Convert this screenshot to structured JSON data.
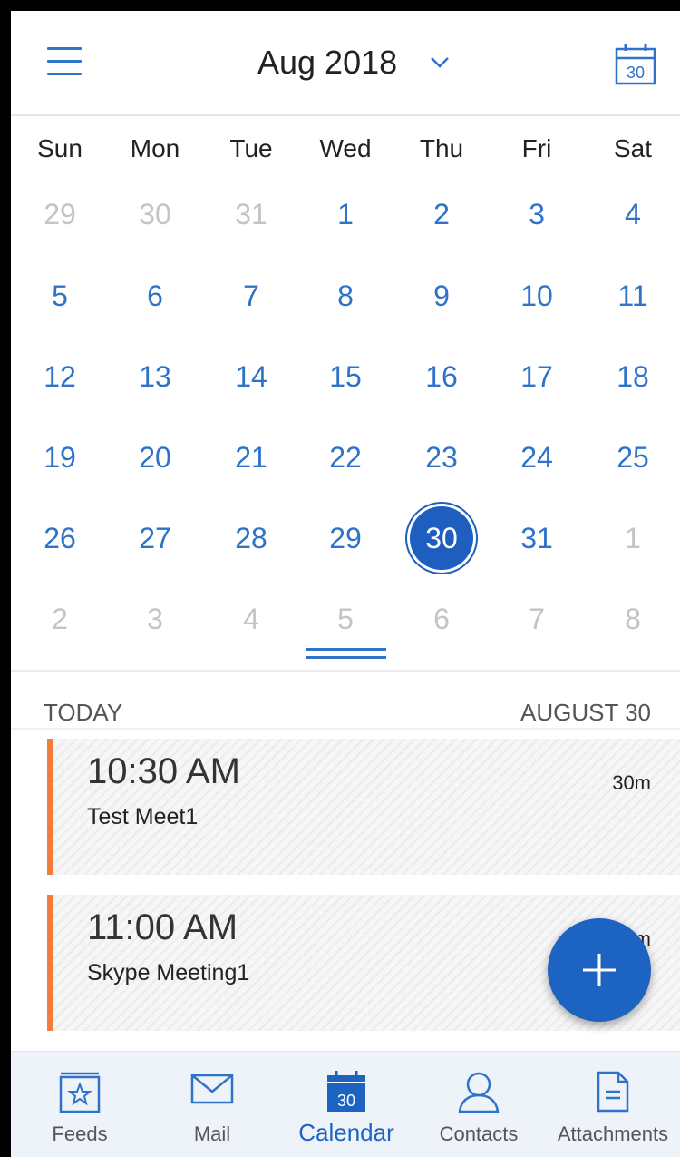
{
  "header": {
    "month_title": "Aug 2018",
    "today_icon_day": "30"
  },
  "weekdays": [
    "Sun",
    "Mon",
    "Tue",
    "Wed",
    "Thu",
    "Fri",
    "Sat"
  ],
  "calendar": {
    "weeks": [
      [
        {
          "d": "29",
          "m": true
        },
        {
          "d": "30",
          "m": true
        },
        {
          "d": "31",
          "m": true
        },
        {
          "d": "1"
        },
        {
          "d": "2"
        },
        {
          "d": "3"
        },
        {
          "d": "4"
        }
      ],
      [
        {
          "d": "5"
        },
        {
          "d": "6"
        },
        {
          "d": "7"
        },
        {
          "d": "8"
        },
        {
          "d": "9"
        },
        {
          "d": "10"
        },
        {
          "d": "11"
        }
      ],
      [
        {
          "d": "12"
        },
        {
          "d": "13"
        },
        {
          "d": "14"
        },
        {
          "d": "15"
        },
        {
          "d": "16"
        },
        {
          "d": "17"
        },
        {
          "d": "18"
        }
      ],
      [
        {
          "d": "19"
        },
        {
          "d": "20"
        },
        {
          "d": "21"
        },
        {
          "d": "22"
        },
        {
          "d": "23"
        },
        {
          "d": "24"
        },
        {
          "d": "25"
        }
      ],
      [
        {
          "d": "26"
        },
        {
          "d": "27"
        },
        {
          "d": "28"
        },
        {
          "d": "29"
        },
        {
          "d": "30",
          "sel": true
        },
        {
          "d": "31"
        },
        {
          "d": "1",
          "m": true
        }
      ],
      [
        {
          "d": "2",
          "m": true
        },
        {
          "d": "3",
          "m": true
        },
        {
          "d": "4",
          "m": true
        },
        {
          "d": "5",
          "m": true
        },
        {
          "d": "6",
          "m": true
        },
        {
          "d": "7",
          "m": true
        },
        {
          "d": "8",
          "m": true
        }
      ]
    ],
    "selected_color": "#1d5ebf"
  },
  "agenda": {
    "today_label": "TODAY",
    "date_label": "AUGUST 30",
    "events": [
      {
        "time": "10:30 AM",
        "title": "Test Meet1",
        "duration": "30m"
      },
      {
        "time": "11:00 AM",
        "title": "Skype Meeting1",
        "duration": "30m"
      }
    ]
  },
  "fab": {
    "icon": "plus-icon"
  },
  "nav": {
    "tabs": [
      {
        "label": "Feeds",
        "icon": "feeds-icon"
      },
      {
        "label": "Mail",
        "icon": "mail-icon"
      },
      {
        "label": "Calendar",
        "icon": "calendar-icon",
        "day": "30",
        "active": true
      },
      {
        "label": "Contacts",
        "icon": "contacts-icon"
      },
      {
        "label": "Attachments",
        "icon": "attachments-icon"
      }
    ]
  },
  "colors": {
    "accent": "#2f73c9",
    "event_bar": "#f27c3c",
    "muted": "#c4c4c4"
  }
}
